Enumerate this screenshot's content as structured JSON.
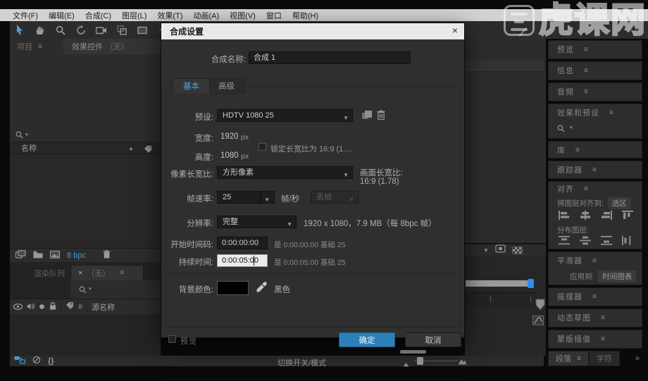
{
  "menu": {
    "items": [
      "文件(F)",
      "编辑(E)",
      "合成(C)",
      "图层(L)",
      "效果(T)",
      "动画(A)",
      "视图(V)",
      "窗口",
      "帮助(H)"
    ]
  },
  "icons": {
    "hamburger": "≡",
    "caret_down": "▼",
    "sort_up": "▲",
    "chevron_more": "»",
    "braces": "{}"
  },
  "watermark": {
    "text": "虎课网"
  },
  "left_panel": {
    "tab_project": "项目",
    "tab_effect_controls": "效果控件",
    "tab_effect_controls_suffix": "（无）",
    "name_column": "名称",
    "bpc_label": "8 bpc",
    "render_queue": "渲染队列",
    "comp_tab_close": "×",
    "comp_tab_label": "（无）",
    "hash": "#",
    "source_name": "源名称"
  },
  "dialog": {
    "title": "合成设置",
    "close": "×",
    "name_label": "合成名称:",
    "name_value": "合成 1",
    "tab_basic": "基本",
    "tab_advanced": "高级",
    "preset_label": "预设:",
    "preset_value": "HDTV 1080 25",
    "width_label": "宽度:",
    "width_value": "1920",
    "width_unit": "px",
    "lock_aspect_label": "锁定长宽比为 16:9 (1....",
    "height_label": "高度:",
    "height_value": "1080",
    "height_unit": "px",
    "par_label": "像素长宽比:",
    "par_value": "方形像素",
    "far_label": "画面长宽比:",
    "far_value": "16:9 (1.78)",
    "fps_label": "帧速率:",
    "fps_value": "25",
    "fps_unit": "帧/秒",
    "drop_frame": "丢帧",
    "res_label": "分辨率:",
    "res_value": "完整",
    "res_info": "1920 x 1080，7.9 MB（每 8bpc 帧）",
    "start_label": "开始时间码:",
    "start_value": "0:00:00:00",
    "start_info": "是 0:00:00:00 基础 25",
    "duration_label": "持续时间:",
    "duration_value": "0:00:05:00",
    "duration_info": "是 0:00:05:00 基础 25",
    "bg_label": "背景颜色:",
    "bg_color_hex": "#000000",
    "bg_name": "黑色",
    "preview_label": "预览",
    "ok_label": "确定",
    "cancel_label": "取消"
  },
  "right_panels": {
    "preview": "预览",
    "info": "信息",
    "audio": "音频",
    "effects_presets": "效果和预设",
    "library": "库",
    "tracker": "跟踪器",
    "align": "对齐",
    "align_to_label": "将图层对齐到:",
    "align_to_value": "选区",
    "distribute_label": "分布图层:",
    "smoother": "平滑器",
    "apply_to_label": "应用到:",
    "apply_to_value": "时间图表",
    "wiggler": "摇摆器",
    "motion_sketch": "动态草图",
    "mask_interp": "蒙版插值",
    "paragraph": "段落",
    "character": "字符"
  },
  "bottom_bar": {
    "toggle_label": "切换开关/模式"
  }
}
